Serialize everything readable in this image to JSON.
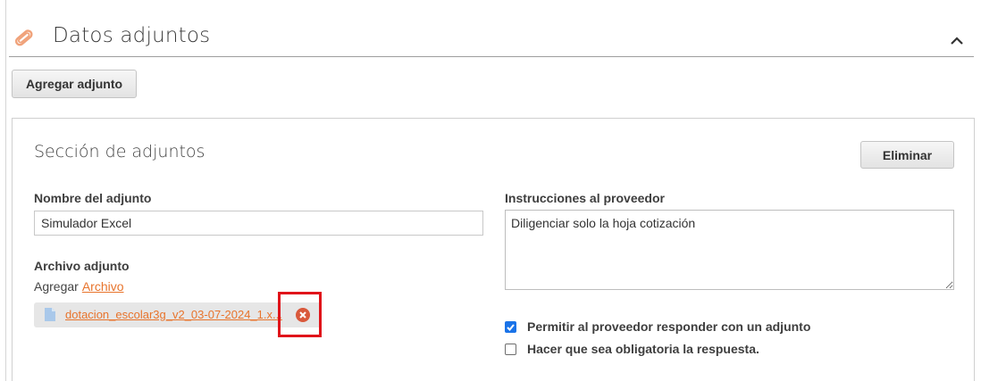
{
  "header": {
    "title": "Datos adjuntos",
    "icon": "paperclip-icon",
    "icon_color": "#f0a27a",
    "collapse_icon": "chevron-up-icon"
  },
  "toolbar": {
    "add_attachment_label": "Agregar adjunto"
  },
  "section": {
    "title": "Sección de adjuntos",
    "delete_label": "Eliminar",
    "name_field": {
      "label": "Nombre del adjunto",
      "value": "Simulador Excel"
    },
    "instructions_field": {
      "label": "Instrucciones al proveedor",
      "value": "Diligenciar solo la hoja cotización"
    },
    "file_field": {
      "label": "Archivo adjunto",
      "add_prefix": "Agregar",
      "add_link": "Archivo",
      "file_name": "dotacion_escolar3g_v2_03-07-2024_1.x...",
      "file_icon": "document-icon",
      "remove_icon": "remove-circle-icon"
    },
    "options": [
      {
        "label": "Permitir al proveedor responder con un adjunto",
        "checked": true
      },
      {
        "label": "Hacer que sea obligatoria la respuesta.",
        "checked": false
      }
    ]
  },
  "colors": {
    "accent_link": "#e8742c",
    "checkbox_checked": "#1a73e8",
    "highlight": "#e0141a",
    "remove_icon": "#d9583b"
  }
}
